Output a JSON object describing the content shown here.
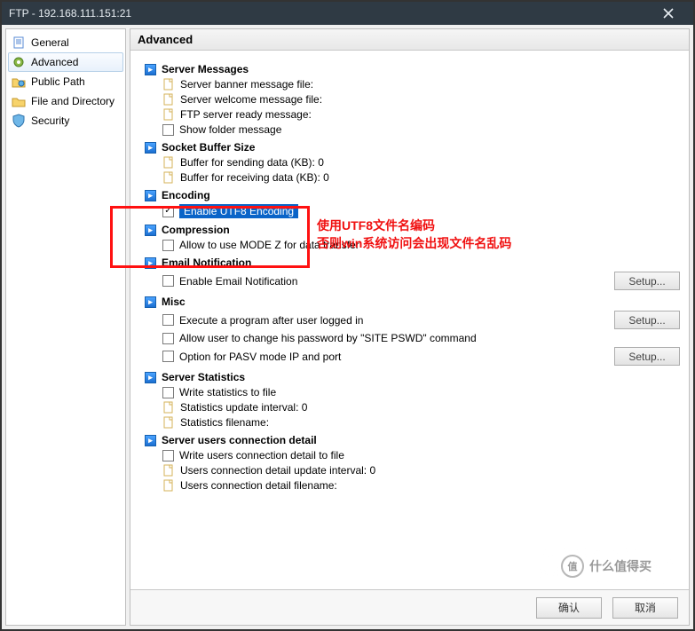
{
  "window": {
    "title": "FTP - 192.168.111.151:21"
  },
  "sidebar": {
    "items": [
      {
        "label": "General"
      },
      {
        "label": "Advanced"
      },
      {
        "label": "Public Path"
      },
      {
        "label": "File and Directory"
      },
      {
        "label": "Security"
      }
    ]
  },
  "content": {
    "title": "Advanced",
    "sections": {
      "server_messages": {
        "title": "Server Messages",
        "banner": "Server banner message file:",
        "welcome": "Server welcome message file:",
        "ready": "FTP server ready message:",
        "show_folder": "Show folder message"
      },
      "socket_buffer": {
        "title": "Socket Buffer Size",
        "send": "Buffer for sending data (KB): 0",
        "recv": "Buffer for receiving data (KB): 0"
      },
      "encoding": {
        "title": "Encoding",
        "enable_utf8": "Enable UTF8 Encoding"
      },
      "compression": {
        "title": "Compression",
        "mode_z": "Allow to use MODE Z for data transfer"
      },
      "email": {
        "title": "Email Notification",
        "enable": "Enable Email Notification",
        "setup": "Setup..."
      },
      "misc": {
        "title": "Misc",
        "execute": "Execute a program after user logged in",
        "site_pswd": "Allow user to change his password by \"SITE PSWD\" command",
        "pasv": "Option for PASV mode IP and port",
        "setup": "Setup..."
      },
      "stats": {
        "title": "Server Statistics",
        "write": "Write statistics to file",
        "interval": "Statistics update interval: 0",
        "filename": "Statistics filename:"
      },
      "conn_detail": {
        "title": "Server users connection detail",
        "write": "Write users connection detail to file",
        "interval": "Users connection detail update interval: 0",
        "filename": "Users connection detail filename:"
      }
    }
  },
  "annotation": {
    "line1": "使用UTF8文件名编码",
    "line2": "否则win系统访问会出现文件名乱码"
  },
  "footer": {
    "ok": "确认",
    "cancel": "取消"
  },
  "watermark": {
    "badge": "值",
    "text": "什么值得买"
  }
}
